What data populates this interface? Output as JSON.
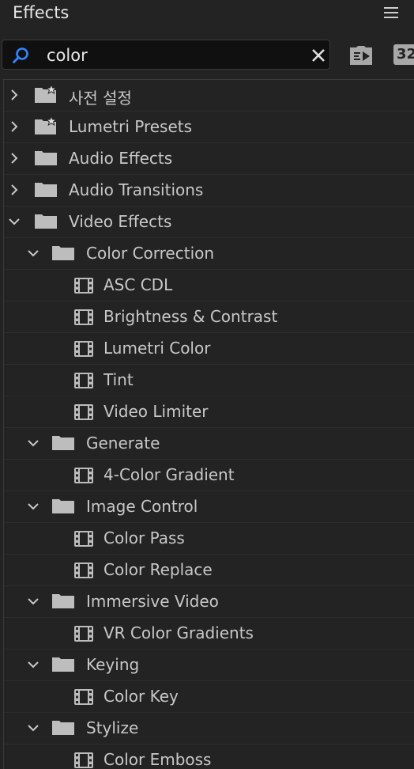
{
  "panel": {
    "title": "Effects"
  },
  "search": {
    "value": "color"
  },
  "toolbar": {
    "btn2_label": "32"
  },
  "tree": {
    "presets_ko": "사전 설정",
    "lumetri_presets": "Lumetri Presets",
    "audio_effects": "Audio Effects",
    "audio_transitions": "Audio Transitions",
    "video_effects": "Video Effects",
    "color_correction": {
      "label": "Color Correction",
      "items": [
        "ASC CDL",
        "Brightness & Contrast",
        "Lumetri Color",
        "Tint",
        "Video Limiter"
      ]
    },
    "generate": {
      "label": "Generate",
      "items": [
        "4-Color Gradient"
      ]
    },
    "image_control": {
      "label": "Image Control",
      "items": [
        "Color Pass",
        "Color Replace"
      ]
    },
    "immersive_video": {
      "label": "Immersive Video",
      "items": [
        "VR Color Gradients"
      ]
    },
    "keying": {
      "label": "Keying",
      "items": [
        "Color Key"
      ]
    },
    "stylize": {
      "label": "Stylize",
      "items": [
        "Color Emboss"
      ]
    }
  }
}
